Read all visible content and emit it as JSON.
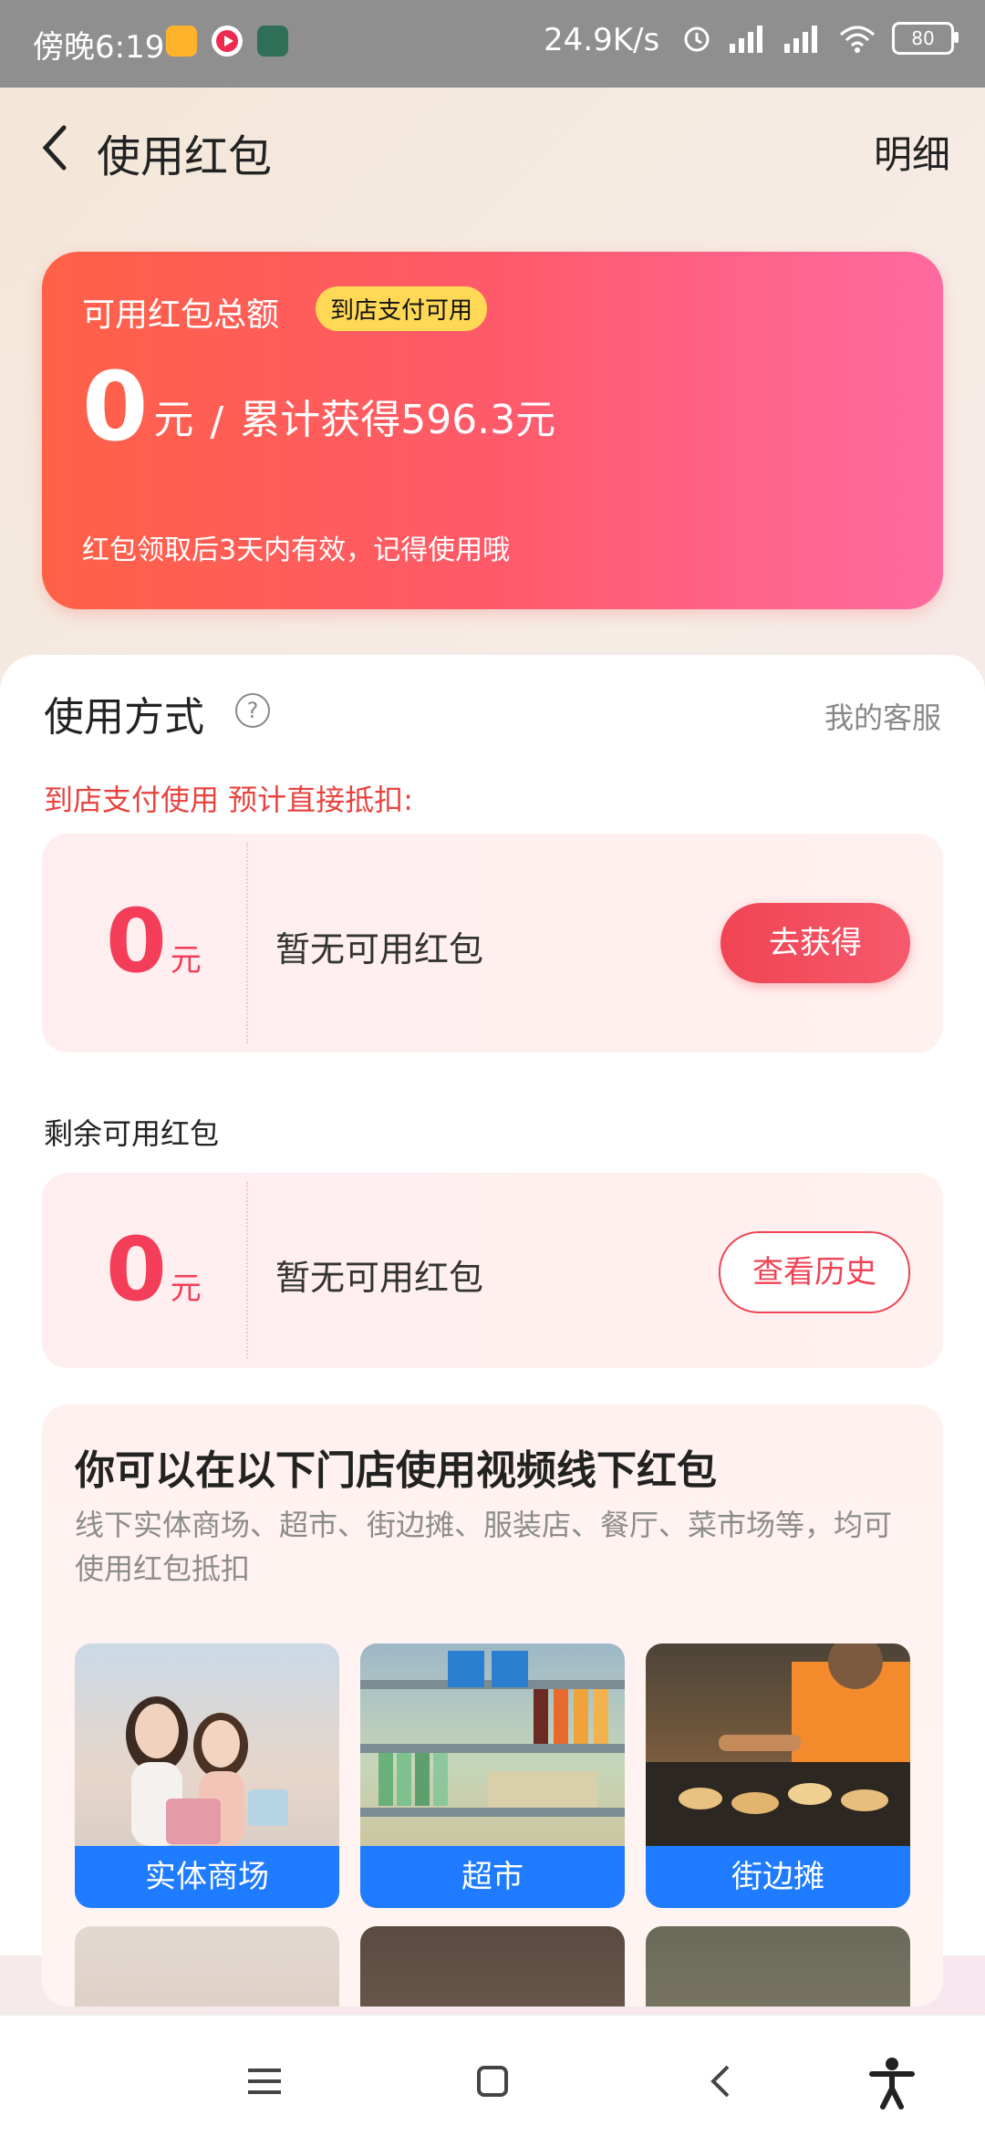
{
  "status_bar": {
    "time": "傍晚6:19",
    "network_speed": "24.9K/s",
    "battery": "80"
  },
  "header": {
    "title": "使用红包",
    "right_link": "明细"
  },
  "hero": {
    "label": "可用红包总额",
    "badge": "到店支付可用",
    "amount": "0",
    "unit": "元",
    "separator": "/",
    "total_text": "累计获得596.3元",
    "note": "红包领取后3天内有效，记得使用哦"
  },
  "usage": {
    "title": "使用方式",
    "service_link": "我的客服",
    "store_pay_note": "到店支付使用 预计直接抵扣:"
  },
  "coupon_store": {
    "amount": "0",
    "unit": "元",
    "text": "暂无可用红包",
    "button": "去获得"
  },
  "remaining": {
    "label": "剩余可用红包",
    "amount": "0",
    "unit": "元",
    "text": "暂无可用红包",
    "button": "查看历史"
  },
  "stores": {
    "title": "你可以在以下门店使用视频线下红包",
    "desc": "线下实体商场、超市、街边摊、服装店、餐厅、菜市场等，均可使用红包抵扣",
    "tiles": [
      "实体商场",
      "超市",
      "街边摊"
    ]
  }
}
